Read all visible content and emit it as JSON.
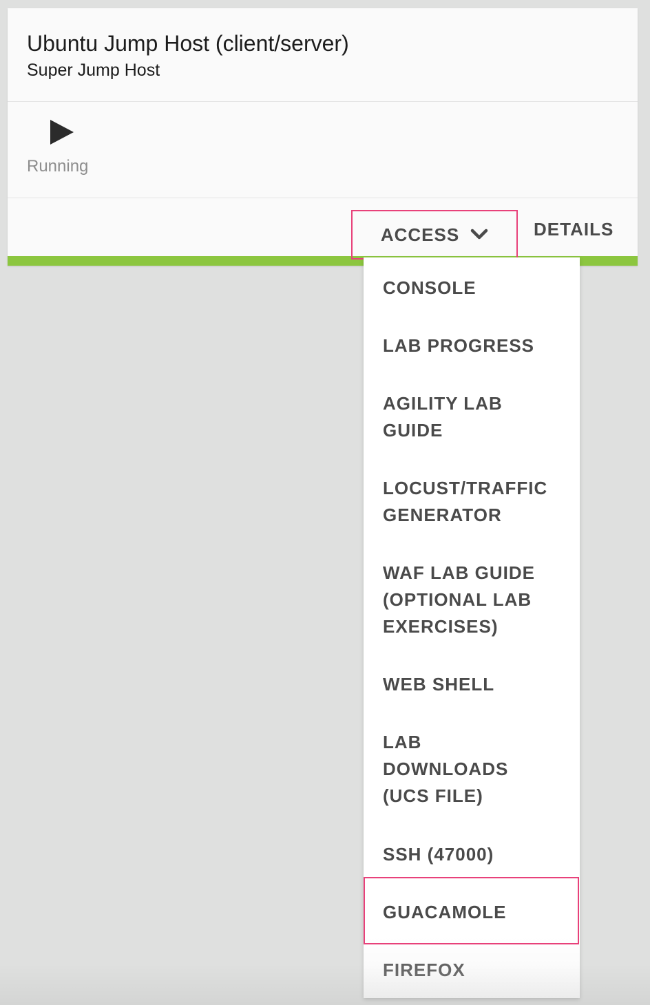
{
  "card": {
    "title": "Ubuntu Jump Host (client/server)",
    "subtitle": "Super Jump Host",
    "status_icon": "play-icon",
    "status_text": "Running",
    "status_color": "#8cc63f"
  },
  "actions": {
    "access_label": "ACCESS",
    "access_icon": "chevron-down-icon",
    "details_label": "DETAILS"
  },
  "access_menu": {
    "items": [
      {
        "label": "CONSOLE"
      },
      {
        "label": "LAB PROGRESS"
      },
      {
        "label": "AGILITY LAB GUIDE"
      },
      {
        "label": "LOCUST/TRAFFIC GENERATOR"
      },
      {
        "label": "WAF LAB GUIDE (OPTIONAL LAB EXERCISES)"
      },
      {
        "label": "WEB SHELL"
      },
      {
        "label": "LAB DOWNLOADS (UCS FILE)"
      },
      {
        "label": "SSH (47000)"
      },
      {
        "label": "GUACAMOLE"
      },
      {
        "label": "FIREFOX"
      }
    ]
  },
  "highlight_color": "#e8417a"
}
